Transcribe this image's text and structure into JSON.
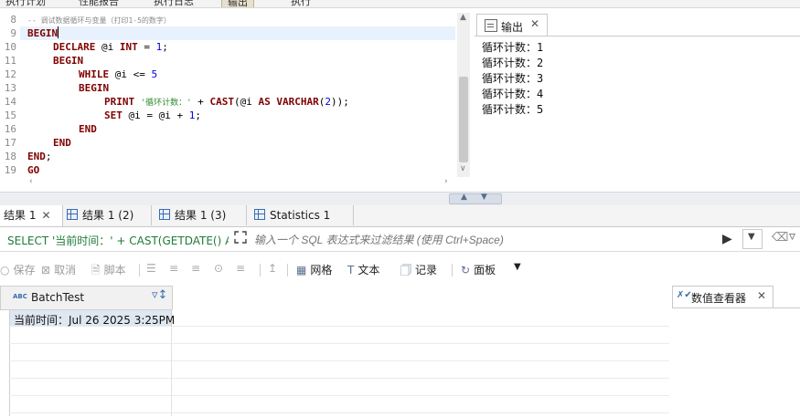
{
  "top_toolbar": {
    "items": [
      "执行计划",
      "性能报告",
      "执行日志",
      "输出",
      "执行"
    ]
  },
  "editor": {
    "line_numbers": [
      "8",
      "9",
      "10",
      "11",
      "12",
      "13",
      "14",
      "15",
      "16",
      "17",
      "18",
      "19"
    ],
    "comment": "-- 调试数据循环与变量（打印1-5的数字）",
    "lines": {
      "l9": "BEGIN",
      "l10a": "DECLARE",
      "l10b": " @i ",
      "l10c": "INT",
      "l10d": " = ",
      "l10e": "1",
      "l10f": ";",
      "l11": "BEGIN",
      "l12a": "WHILE",
      "l12b": " @i <= ",
      "l12c": "5",
      "l13": "BEGIN",
      "l14a": "PRINT",
      "l14b": " ",
      "l14c": "'循环计数：'",
      "l14d": " + ",
      "l14e": "CAST",
      "l14f": "(@i ",
      "l14g": "AS",
      "l14h": " ",
      "l14i": "VARCHAR",
      "l14j": "(",
      "l14k": "2",
      "l14l": "));",
      "l15a": "SET",
      "l15b": " @i = @i + ",
      "l15c": "1",
      "l15d": ";",
      "l16": "END",
      "l17": "END",
      "l18a": "END",
      "l18b": ";",
      "l19": "GO"
    }
  },
  "output": {
    "tab_label": "输出",
    "lines": [
      "循环计数：1",
      "循环计数：2",
      "循环计数：3",
      "循环计数：4",
      "循环计数：5"
    ]
  },
  "result_tabs": [
    {
      "label": "结果 1"
    },
    {
      "label": "结果 1 (2)"
    },
    {
      "label": "结果 1 (3)"
    },
    {
      "label": "Statistics 1"
    }
  ],
  "filter": {
    "query": "SELECT '当前时间：' + CAST(GETDATE() AS",
    "placeholder": "输入一个 SQL 表达式来过滤结果 (使用 Ctrl+Space)"
  },
  "actions": {
    "save": "保存",
    "cancel": "取消",
    "script": "脚本",
    "grid": "网格",
    "text": "文本",
    "record": "记录",
    "panels": "面板"
  },
  "grid": {
    "column": "BatchTest",
    "cell": "当前时间：Jul 26 2025  3:25PM"
  },
  "value_viewer": {
    "label": "数值查看器"
  },
  "colors": {
    "keyword": "#7f0000",
    "string": "#2e8b2e",
    "number": "#0000dd",
    "accent": "#3a6cb0"
  }
}
